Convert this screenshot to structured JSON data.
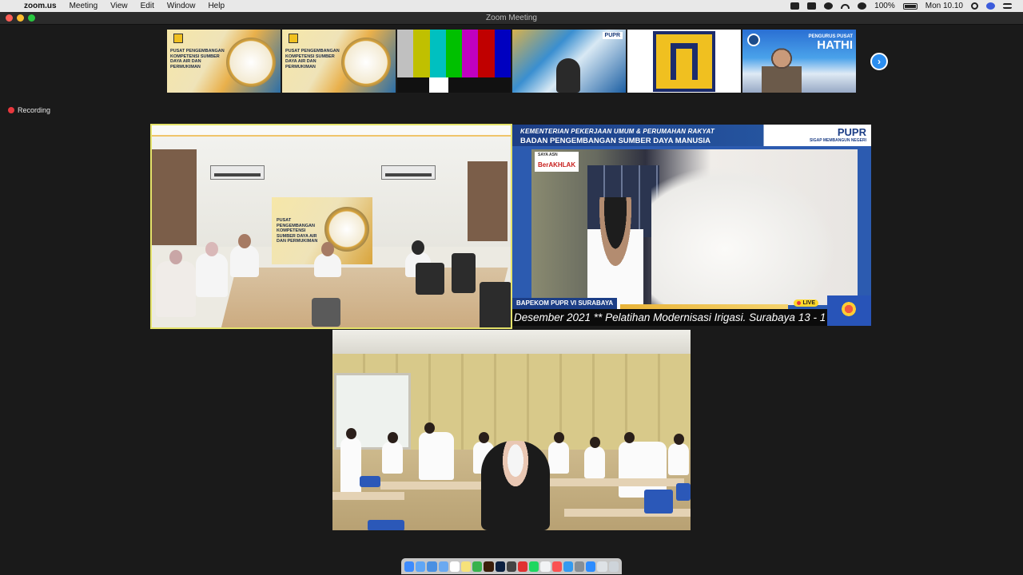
{
  "menubar": {
    "app_name": "zoom.us",
    "menus": [
      "Meeting",
      "View",
      "Edit",
      "Window",
      "Help"
    ],
    "battery": "100%",
    "clock": "Mon 10.10"
  },
  "window": {
    "title": "Zoom Meeting"
  },
  "recording": {
    "label": "Recording"
  },
  "thumbnails": {
    "pusat_title": "PUSAT PENGEMBANGAN KOMPETENSI SUMBER DAYA AIR DAN PERMUKIMAN",
    "woman_badge": "PUPR",
    "hathi_small": "PENGURUS PUSAT",
    "hathi_big": "HATHI"
  },
  "meeting_tile": {
    "banner_text": "PUSAT PENGEMBANGAN KOMPETENSI SUMBER DAYA AIR DAN PERMUKIMAN"
  },
  "stream_tile": {
    "header_line1": "KEMENTERIAN PEKERJAAN UMUM & PERUMAHAN RAKYAT",
    "header_line2": "BADAN PENGEMBANGAN SUMBER DAYA MANUSIA",
    "brand": "PUPR",
    "brand_sub": "SIGAP MEMBANGUN NEGERI",
    "badge_small": "SAYA ASN",
    "badge_big": "BerAKHLAK",
    "lower_third": "BAPEKOM PUPR VI SURABAYA",
    "live": "LIVE",
    "ticker": "Desember 2021 ** Pelatihan Modernisasi Irigasi. Surabaya 13 - 1"
  },
  "colors": {
    "accent_blue": "#2b8ef0",
    "active_speaker_border": "#e5e36a",
    "recording_red": "#e8383d"
  }
}
